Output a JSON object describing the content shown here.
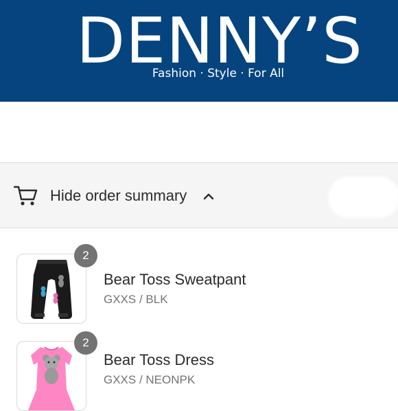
{
  "brand": {
    "name": "DENNY’S",
    "tagline": "Fashion · Style · For All",
    "color": "#05447f"
  },
  "order_summary": {
    "toggle_label": "Hide order summary",
    "cart_icon": "cart-icon",
    "chevron_icon": "chevron-up-icon"
  },
  "items": [
    {
      "name": "Bear Toss Sweatpant",
      "variant": "GXXS / BLK",
      "quantity": "2"
    },
    {
      "name": "Bear Toss Dress",
      "variant": "GXXS / NEONPK",
      "quantity": "2"
    }
  ]
}
